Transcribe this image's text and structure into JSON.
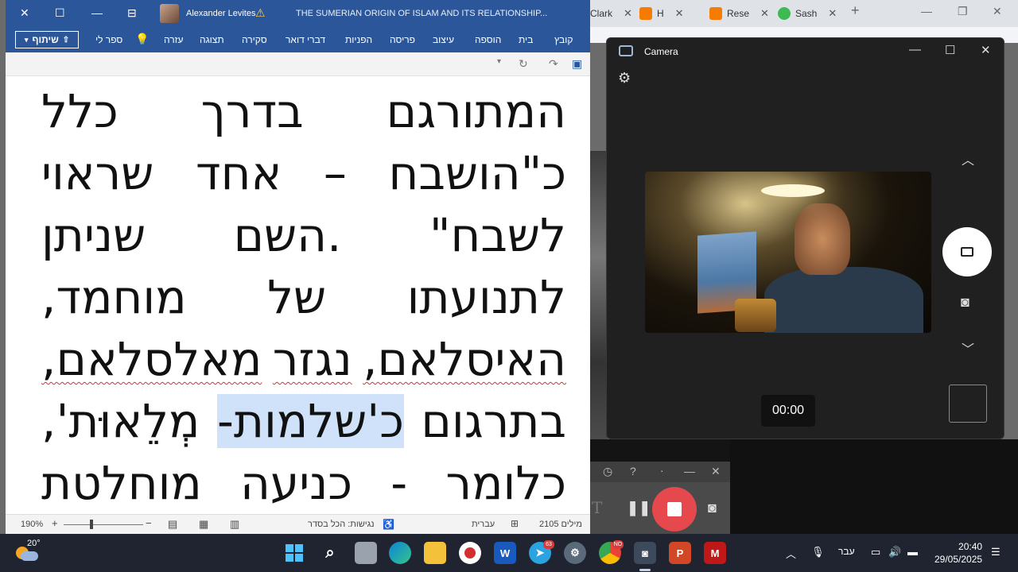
{
  "browser": {
    "tabs": [
      {
        "label": "Clark",
        "color": "#888888"
      },
      {
        "label": "H",
        "color": "#f57c00"
      },
      {
        "label": "Rese",
        "color": "#f57c00"
      },
      {
        "label": "Sash",
        "color": "#3cba54"
      }
    ],
    "new_tab": "+"
  },
  "word": {
    "user_name": "Alexander Levites",
    "doc_title": "THE SUMERIAN ORIGIN OF ISLAM AND ITS RELATIONSHIP...",
    "share_label": "שיתוף",
    "ribbon_tabs": [
      "קובץ",
      "בית",
      "הוספה",
      "עיצוב",
      "פריסה",
      "הפניות",
      "דברי דואר",
      "סקירה",
      "תצוגה",
      "עזרה",
      "ספר לי"
    ],
    "lines": [
      [
        "המתורגם",
        "בדרך",
        "כלל"
      ],
      [
        "כ\"הושבח",
        "–",
        "אחד",
        "שראוי"
      ],
      [
        "לשבח\"",
        ".השם",
        "שניתן"
      ],
      [
        "לתנועתו",
        "של",
        "מוחמד,"
      ],
      [
        "האיסלאם,",
        "נגזר",
        "מאלסלאם,"
      ],
      [
        "בתרגום",
        "כ'שלמות-",
        "מְלֵאוּת',"
      ],
      [
        "כלומר",
        "-",
        "כניעה",
        "מוחלטת"
      ]
    ],
    "status": {
      "words": "2105 מילים",
      "language": "עברית",
      "accessibility": "נגישות: הכל בסדר",
      "zoom": "190%",
      "zoom_level": 0.65
    }
  },
  "camera": {
    "title": "Camera",
    "timer": "00:00"
  },
  "taskbar": {
    "temperature": "20°",
    "telegram_badge": "63",
    "chrome_badge": "NO",
    "input_lang": "עבר",
    "time": "20:40",
    "date": "29/05/2025"
  },
  "colors": {
    "word_blue": "#2b579a",
    "taskbar": "#1f2430",
    "stop_red": "#e5484d"
  }
}
